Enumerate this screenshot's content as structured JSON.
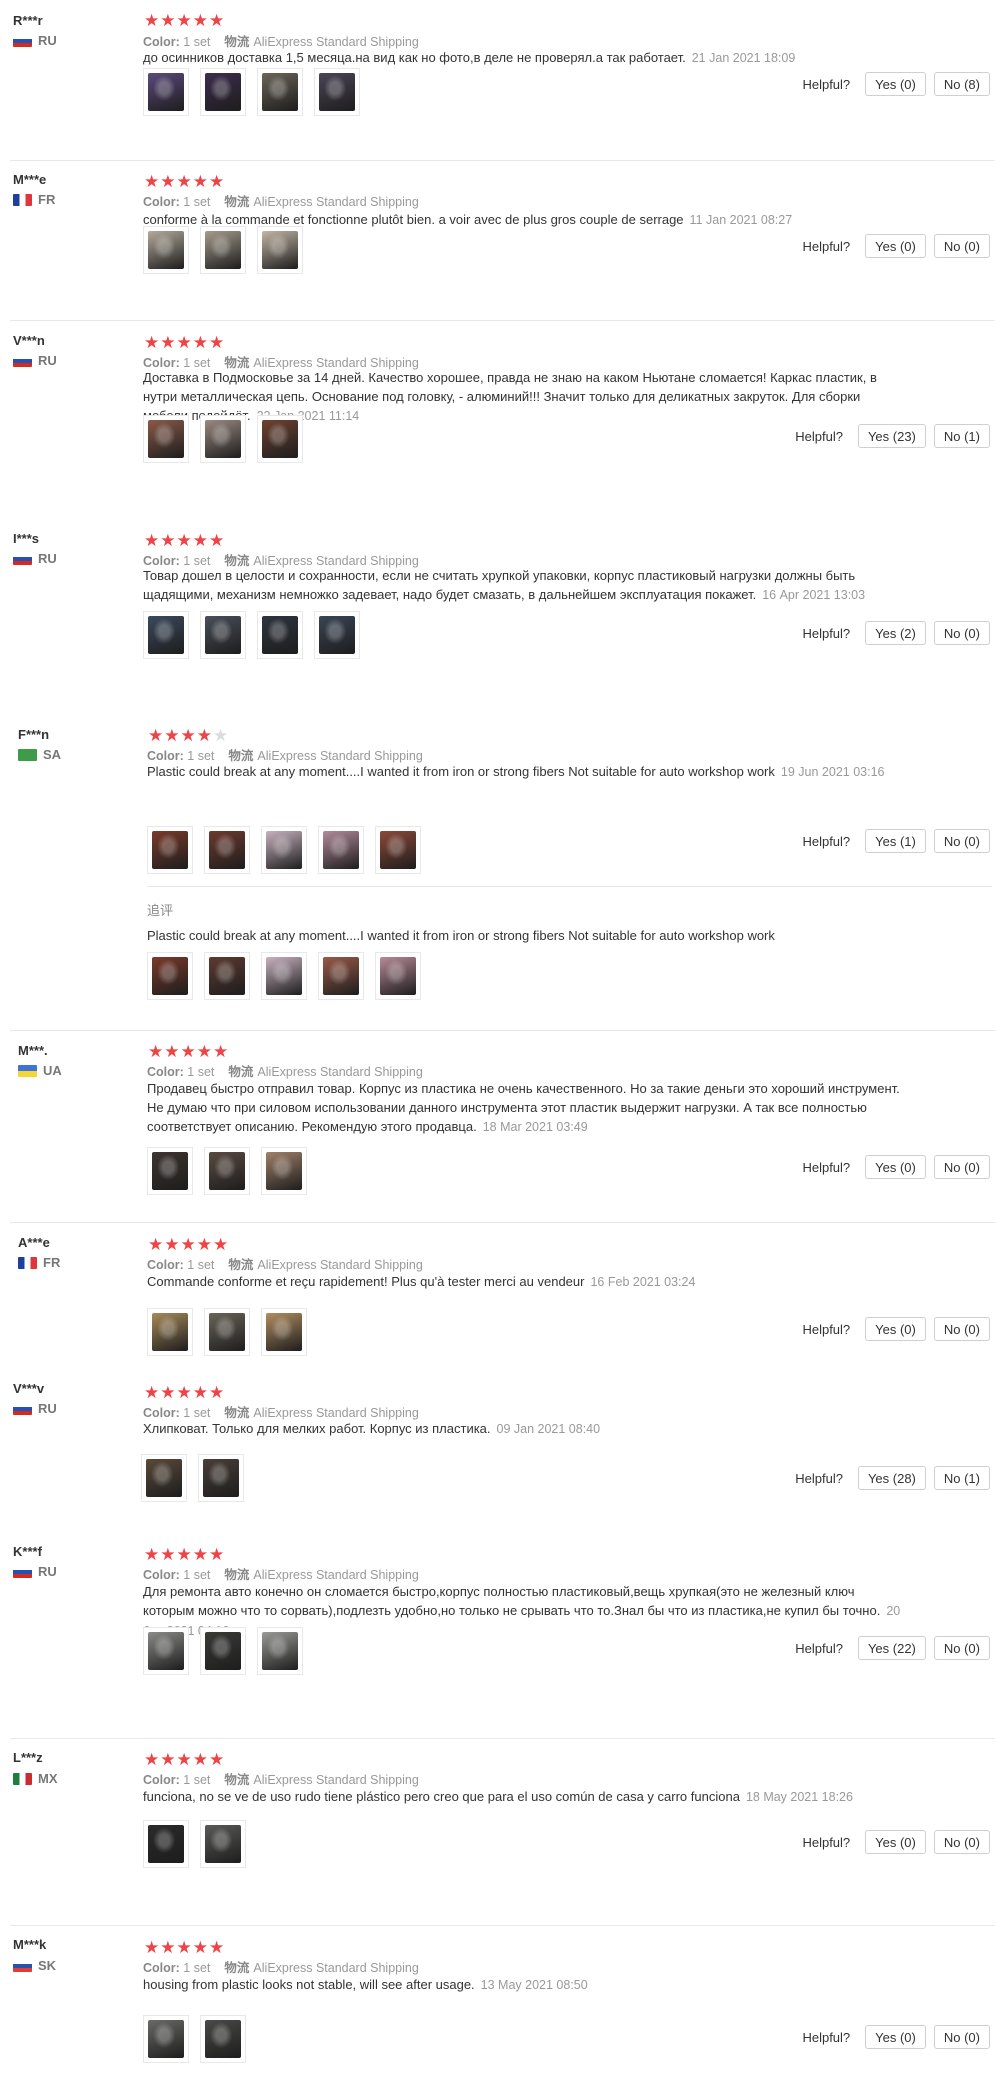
{
  "labels": {
    "color": "Color:",
    "shipping": "物流",
    "helpful": "Helpful?",
    "followup": "追评"
  },
  "colors": {
    "star": "#ee4448",
    "star_empty": "#dcdcdc",
    "text": "#333333",
    "muted": "#999999"
  },
  "reviews": [
    {
      "user": "R***r",
      "country": "RU",
      "flag": "ru",
      "rating": 5,
      "color_value": "1 set",
      "shipping": "AliExpress Standard Shipping",
      "text": "до осинников доставка 1,5 месяца.на вид как но фото,в деле не проверял.а так работает.",
      "date": "21 Jan 2021 18:09",
      "yes": "Yes (0)",
      "no": "No (8)",
      "photos": [
        "#5b4a7e",
        "#3d2d4e",
        "#6c6558",
        "#4c4457"
      ]
    },
    {
      "user": "M***e",
      "country": "FR",
      "flag": "fr",
      "rating": 5,
      "color_value": "1 set",
      "shipping": "AliExpress Standard Shipping",
      "text": "conforme à la commande et fonctionne plutôt bien. a voir avec de plus gros couple de serrage",
      "date": "11 Jan 2021 08:27",
      "yes": "Yes (0)",
      "no": "No (0)",
      "photos": [
        "#b5aa9b",
        "#a69c8c",
        "#c3b6a4"
      ]
    },
    {
      "user": "V***n",
      "country": "RU",
      "flag": "ru",
      "rating": 5,
      "color_value": "1 set",
      "shipping": "AliExpress Standard Shipping",
      "text": "Доставка в Подмосковье за 14 дней. Качество хорошее, правда не знаю на каком Ньютане сломается! Каркас пластик, в нутри металлическая цепь. Основание под головку, - алюминий!!! Значит только для деликатных закруток. Для сборки мебели подойдёт.",
      "date": "22 Jan 2021 11:14",
      "yes": "Yes (23)",
      "no": "No (1)",
      "photos": [
        "#8a5a48",
        "#9b8a80",
        "#6e4230"
      ]
    },
    {
      "user": "I***s",
      "country": "RU",
      "flag": "ru",
      "rating": 5,
      "color_value": "1 set",
      "shipping": "AliExpress Standard Shipping",
      "text": "Товар дошел в целости и сохранности, если не считать хрупкой упаковки, корпус пластиковый нагрузки должны быть щадящими, механизм немножко задевает, надо будет смазать, в дальнейшем эксплуатация покажет.",
      "date": "16 Apr 2021 13:03",
      "yes": "Yes (2)",
      "no": "No (0)",
      "photos": [
        "#3b4a5e",
        "#4a4f5a",
        "#2f3440",
        "#3a4556"
      ]
    },
    {
      "user": "F***n",
      "country": "SA",
      "flag": "sa",
      "rating": 4,
      "color_value": "1 set",
      "shipping": "AliExpress Standard Shipping",
      "text": "Plastic could break at any moment....I wanted it from iron or strong fibers Not suitable for auto workshop work",
      "date": "19 Jun 2021 03:16",
      "yes": "Yes (1)",
      "no": "No (0)",
      "photos": [
        "#7a3a2a",
        "#6e3a2e",
        "#c9b2c0",
        "#b38a9a",
        "#8c4a38"
      ],
      "followup_text": "Plastic could break at any moment....I wanted it from iron or strong fibers Not suitable for auto workshop work",
      "followup_photos": [
        "#7a3a2a",
        "#5e3a30",
        "#c9b2c0",
        "#9a5a48",
        "#b88a98"
      ]
    },
    {
      "user": "M***.",
      "country": "UA",
      "flag": "ua",
      "rating": 5,
      "color_value": "1 set",
      "shipping": "AliExpress Standard Shipping",
      "text": "Продавец быстро отправил товар. Корпус из пластика не очень качественного. Но за такие деньги это хороший инструмент. Не думаю что при силовом использовании данного инструмента этот пластик выдержит нагрузки. А так все полностью соответствует описанию. Рекомендую этого продавца.",
      "date": "18 Mar 2021 03:49",
      "yes": "Yes (0)",
      "no": "No (0)",
      "photos": [
        "#3e3430",
        "#5a4a40",
        "#a08068"
      ]
    },
    {
      "user": "A***e",
      "country": "FR",
      "flag": "fr",
      "rating": 5,
      "color_value": "1 set",
      "shipping": "AliExpress Standard Shipping",
      "text": "Commande conforme et reçu rapidement! Plus qu'à tester merci au vendeur",
      "date": "16 Feb 2021 03:24",
      "yes": "Yes (0)",
      "no": "No (0)",
      "photos": [
        "#a88a5a",
        "#6a6458",
        "#b38e60"
      ]
    },
    {
      "user": "V***v",
      "country": "RU",
      "flag": "ru",
      "rating": 5,
      "color_value": "1 set",
      "shipping": "AliExpress Standard Shipping",
      "text": "Хлипковат. Только для мелких работ. Корпус из пластика.",
      "date": "09 Jan 2021 08:40",
      "yes": "Yes (28)",
      "no": "No (1)",
      "photos": [
        "#5a4a3a",
        "#4a3e38"
      ]
    },
    {
      "user": "K***f",
      "country": "RU",
      "flag": "ru",
      "rating": 5,
      "color_value": "1 set",
      "shipping": "AliExpress Standard Shipping",
      "text": "Для ремонта авто конечно он сломается быстро,корпус полностью пластиковый,вещь хрупкая(это не железный ключ которым можно что то сорвать),подлезть удобно,но только не срывать что то.Знал бы что из пластика,не купил бы точно.",
      "date": "20 Jan 2021 04:16",
      "yes": "Yes (22)",
      "no": "No (0)",
      "photos": [
        "#8a8a88",
        "#3a3a36",
        "#9a9a98"
      ]
    },
    {
      "user": "L***z",
      "country": "MX",
      "flag": "mx",
      "rating": 5,
      "color_value": "1 set",
      "shipping": "AliExpress Standard Shipping",
      "text": "funciona, no se ve de uso rudo tiene plástico pero creo que para el uso común de casa y carro funciona",
      "date": "18 May 2021 18:26",
      "yes": "Yes (0)",
      "no": "No (0)",
      "photos": [
        "#2a2a2a",
        "#5a5a58"
      ]
    },
    {
      "user": "M***k",
      "country": "SK",
      "flag": "sk",
      "rating": 5,
      "color_value": "1 set",
      "shipping": "AliExpress Standard Shipping",
      "text": "housing from plastic looks not stable, will see after usage.",
      "date": "13 May 2021 08:50",
      "yes": "Yes (0)",
      "no": "No (0)",
      "photos": [
        "#6a6a68",
        "#4a4a48"
      ]
    }
  ]
}
